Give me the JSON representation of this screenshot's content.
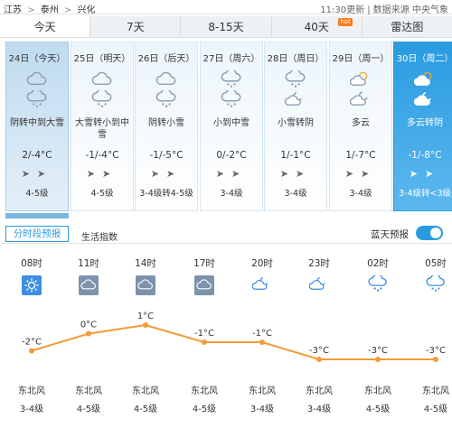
{
  "breadcrumb": [
    "江苏",
    "泰州",
    "兴化"
  ],
  "breadcrumb_sep": ">",
  "update_text": "11:30更新 | 数据来源 中央气象",
  "tabs": [
    {
      "label": "今天",
      "active": true
    },
    {
      "label": "7天",
      "active": false
    },
    {
      "label": "8-15天",
      "active": false
    },
    {
      "label": "40天",
      "active": false,
      "badge": "hot"
    },
    {
      "label": "雷达图",
      "active": false
    }
  ],
  "days": [
    {
      "date": "24日（今天）",
      "desc": "阴转中到大雪",
      "temp": "2/-4°C",
      "wind": "4-5级",
      "icon1": "overcast",
      "icon2": "snow",
      "state": "active"
    },
    {
      "date": "25日（明天）",
      "desc": "大雪转小到中雪",
      "temp": "-1/-4°C",
      "wind": "4-5级",
      "icon1": "overcast",
      "icon2": "snow",
      "state": "normal"
    },
    {
      "date": "26日（后天）",
      "desc": "阴转小雪",
      "temp": "-1/-5°C",
      "wind": "3-4级转4-5级",
      "icon1": "overcast",
      "icon2": "snow",
      "state": "normal"
    },
    {
      "date": "27日（周六）",
      "desc": "小到中雪",
      "temp": "0/-2°C",
      "wind": "3-4级",
      "icon1": "snow",
      "icon2": "snow",
      "state": "normal"
    },
    {
      "date": "28日（周日）",
      "desc": "小雪转阴",
      "temp": "1/-1°C",
      "wind": "3-4级",
      "icon1": "snow",
      "icon2": "overcast-night",
      "state": "normal"
    },
    {
      "date": "29日（周一）",
      "desc": "多云",
      "temp": "1/-7°C",
      "wind": "3-4级",
      "icon1": "cloudy",
      "icon2": "cloudy-night",
      "state": "normal"
    },
    {
      "date": "30日（周二）",
      "desc": "多云转阴",
      "temp": "-1/-8°C",
      "wind": "3-4级转<3级",
      "icon1": "cloudy",
      "icon2": "overcast-night",
      "state": "future"
    }
  ],
  "subtabs": {
    "hourly": "分时段预报",
    "index": "生活指数",
    "bluesky": "蓝天预报"
  },
  "hours": [
    {
      "time": "08时",
      "icon": "sunny",
      "temp": "-2°C",
      "temp_value": -2,
      "wind_dir": "东北风",
      "wind_level": "3-4级"
    },
    {
      "time": "11时",
      "icon": "overcast",
      "temp": "0°C",
      "temp_value": 0,
      "wind_dir": "东北风",
      "wind_level": "4-5级"
    },
    {
      "time": "14时",
      "icon": "overcast",
      "temp": "1°C",
      "temp_value": 1,
      "wind_dir": "东北风",
      "wind_level": "4-5级"
    },
    {
      "time": "17时",
      "icon": "overcast",
      "temp": "-1°C",
      "temp_value": -1,
      "wind_dir": "东北风",
      "wind_level": "4-5级"
    },
    {
      "time": "20时",
      "icon": "overcast-night",
      "temp": "-1°C",
      "temp_value": -1,
      "wind_dir": "东北风",
      "wind_level": "3-4级"
    },
    {
      "time": "23时",
      "icon": "overcast-night",
      "temp": "-3°C",
      "temp_value": -3,
      "wind_dir": "东北风",
      "wind_level": "3-4级"
    },
    {
      "time": "02时",
      "icon": "snow",
      "temp": "-3°C",
      "temp_value": -3,
      "wind_dir": "东北风",
      "wind_level": "4-5级"
    },
    {
      "time": "05时",
      "icon": "snow",
      "temp": "-3°C",
      "temp_value": -3,
      "wind_dir": "东北风",
      "wind_level": "4-5级"
    }
  ],
  "colors": {
    "accent": "#2a9be0",
    "line": "#f29b38",
    "point": "#f29b38"
  }
}
